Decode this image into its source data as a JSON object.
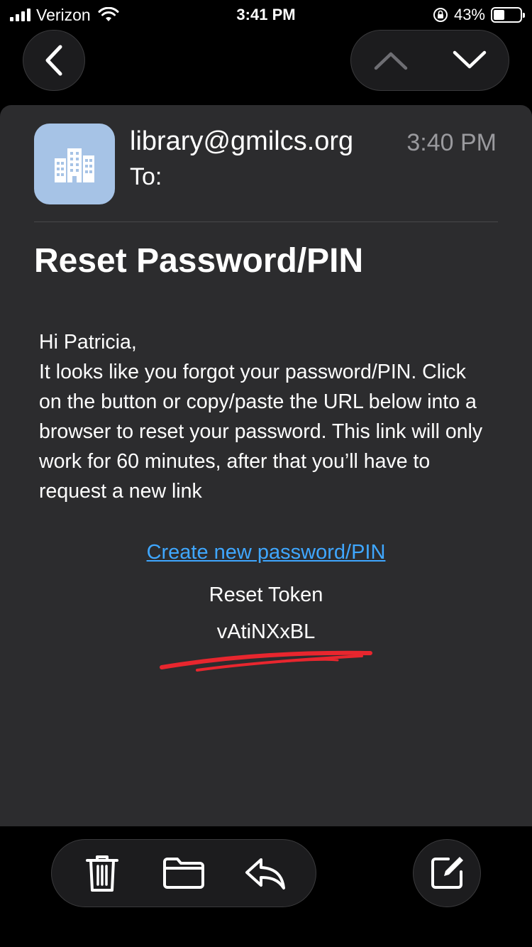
{
  "status_bar": {
    "carrier": "Verizon",
    "time": "3:41 PM",
    "battery": "43%",
    "battery_level": 0.43
  },
  "nav": {
    "back_icon": "chevron-left-icon",
    "prev_icon": "chevron-up-icon",
    "next_icon": "chevron-down-icon"
  },
  "email": {
    "sender": "library@gmilcs.org",
    "to_label": "To:",
    "time": "3:40 PM",
    "subject": "Reset Password/PIN",
    "greeting": "Hi Patricia,",
    "body": "It looks like you forgot your password/PIN. Click on the button or copy/paste the URL below into a browser to reset your password. This link will only work for 60 minutes, after that you’ll have to request a new link",
    "link_text": "Create new password/PIN",
    "token_label": "Reset Token",
    "token_visible": "vAtiNXxBL"
  },
  "toolbar": {
    "trash_icon": "trash-icon",
    "folder_icon": "folder-icon",
    "reply_icon": "reply-icon",
    "compose_icon": "compose-icon"
  },
  "colors": {
    "link": "#3fa7ff",
    "card": "#2c2c2e",
    "avatar": "#a6c3e6",
    "redaction": "#e8262e"
  }
}
